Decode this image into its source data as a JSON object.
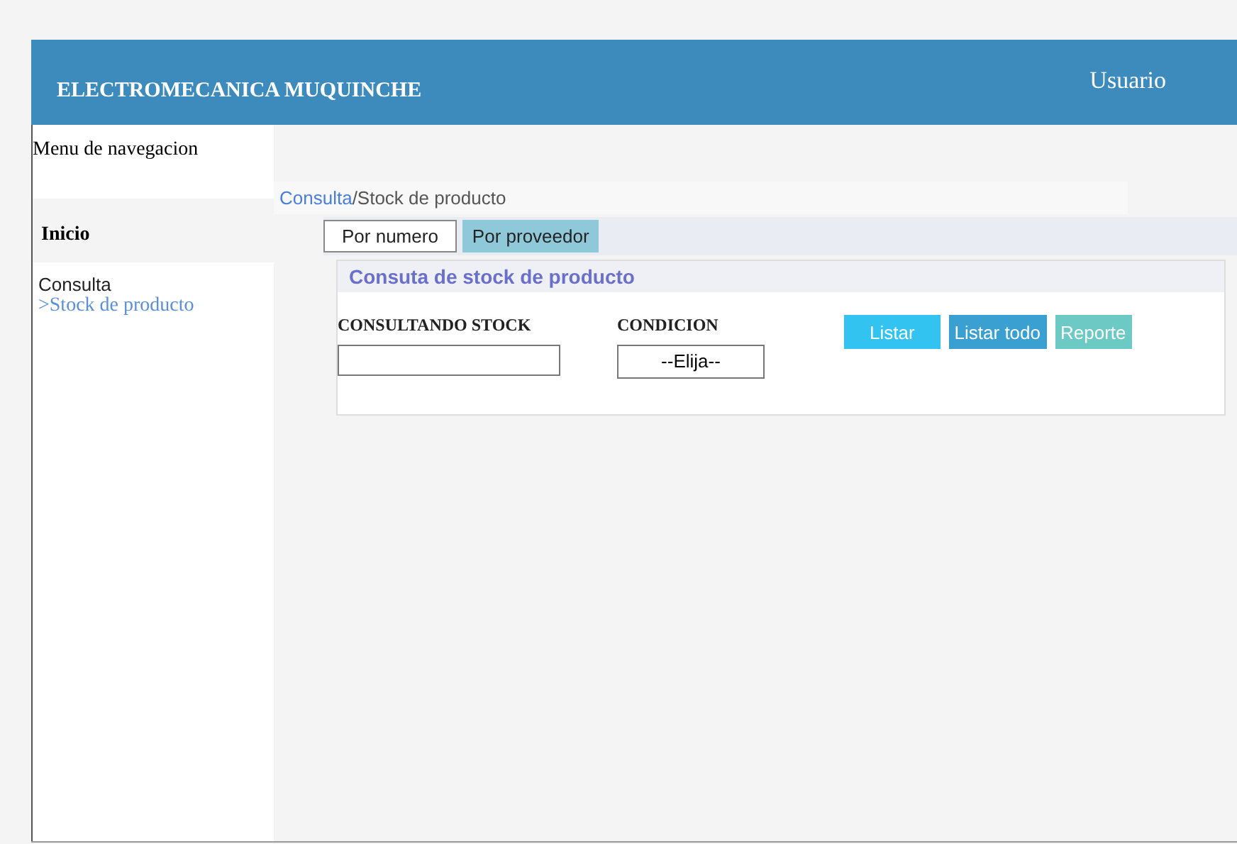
{
  "header": {
    "brand": "ELECTROMECANICA MUQUINCHE",
    "user": "Usuario"
  },
  "sidebar": {
    "title": "Menu de navegacion",
    "section": "Inicio",
    "items": [
      {
        "label": "Consulta",
        "kind": "group"
      },
      {
        "label": ">Stock de producto",
        "kind": "link"
      }
    ]
  },
  "breadcrumb": {
    "link": "Consulta",
    "current": "/Stock de producto"
  },
  "tabs": [
    {
      "label": "Por numero",
      "selected": false
    },
    {
      "label": "Por proveedor",
      "selected": true
    }
  ],
  "panel": {
    "title": "Consuta de stock de producto",
    "fields": [
      {
        "label": "CONSULTANDO STOCK",
        "kind": "text"
      },
      {
        "label": "CONDICION",
        "kind": "select",
        "value": "--Elija--"
      }
    ],
    "buttons": [
      {
        "label": "Listar",
        "color": "#33c3f0"
      },
      {
        "label": "Listar todo",
        "color": "#3a9fd1"
      },
      {
        "label": "Reporte",
        "color": "#6cc9c3"
      }
    ]
  }
}
